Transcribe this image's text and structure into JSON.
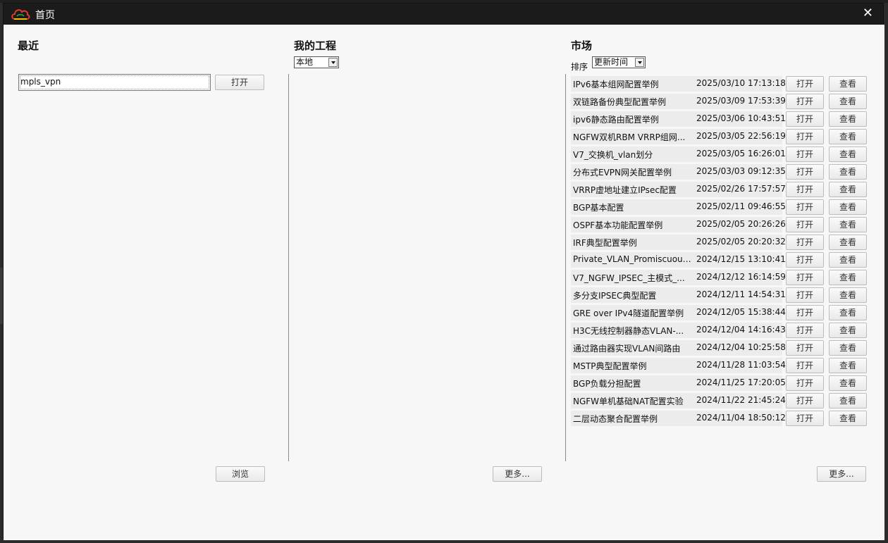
{
  "window": {
    "title": "首页",
    "close_label": "✕"
  },
  "recent": {
    "heading": "最近",
    "input_value": "mpls_vpn",
    "open_label": "打开",
    "browse_label": "浏览"
  },
  "projects": {
    "heading": "我的工程",
    "source_selected": "本地",
    "more_label": "更多..."
  },
  "market": {
    "heading": "市场",
    "sort_label": "排序",
    "sort_selected": "更新时间",
    "more_label": "更多...",
    "open_label": "打开",
    "view_label": "查看",
    "items": [
      {
        "name": "IPv6基本组网配置举例",
        "date": "2025/03/10 17:13:18"
      },
      {
        "name": "双链路备份典型配置举例",
        "date": "2025/03/09 17:53:39"
      },
      {
        "name": "ipv6静态路由配置举例",
        "date": "2025/03/06 10:43:51"
      },
      {
        "name": "NGFW双机RBM VRRP组网...",
        "date": "2025/03/05 22:56:19"
      },
      {
        "name": "V7_交换机_vlan划分",
        "date": "2025/03/05 16:26:01"
      },
      {
        "name": "分布式EVPN网关配置举例",
        "date": "2025/03/03 09:12:35"
      },
      {
        "name": "VRRP虚地址建立IPsec配置",
        "date": "2025/02/26 17:57:57"
      },
      {
        "name": "BGP基本配置",
        "date": "2025/02/11 09:46:55"
      },
      {
        "name": "OSPF基本功能配置举例",
        "date": "2025/02/05 20:26:26"
      },
      {
        "name": "IRF典型配置举例",
        "date": "2025/02/05 20:20:32"
      },
      {
        "name": "Private_VLAN_Promiscuous...",
        "date": "2024/12/15 13:10:41"
      },
      {
        "name": "V7_NGFW_IPSEC_主模式_...",
        "date": "2024/12/12 16:14:59"
      },
      {
        "name": "多分支IPSEC典型配置",
        "date": "2024/12/11 14:54:31"
      },
      {
        "name": "GRE over IPv4隧道配置举例",
        "date": "2024/12/05 15:38:44"
      },
      {
        "name": "H3C无线控制器静态VLAN-...",
        "date": "2024/12/04 14:16:43"
      },
      {
        "name": "通过路由器实现VLAN间路由",
        "date": "2024/12/04 10:25:58"
      },
      {
        "name": "MSTP典型配置举例",
        "date": "2024/11/28 11:03:54"
      },
      {
        "name": "BGP负载分担配置",
        "date": "2024/11/25 17:20:05"
      },
      {
        "name": "NGFW单机基础NAT配置实验",
        "date": "2024/11/22 21:45:24"
      },
      {
        "name": "二层动态聚合配置举例",
        "date": "2024/11/04 18:50:12"
      }
    ]
  }
}
